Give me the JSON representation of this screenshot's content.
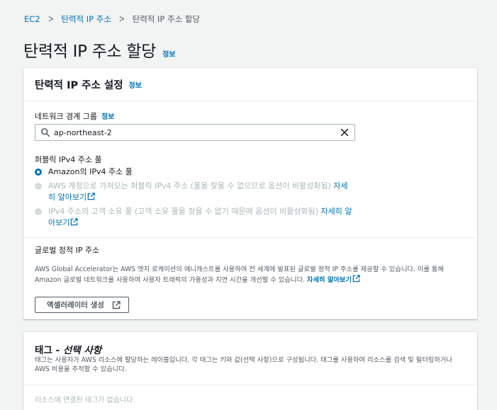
{
  "breadcrumb": {
    "items": [
      "EC2",
      "탄력적 IP 주소",
      "탄력적 IP 주소 할당"
    ]
  },
  "page": {
    "title": "탄력적 IP 주소 할당",
    "info": "정보"
  },
  "settings": {
    "title": "탄력적 IP 주소 설정",
    "info": "정보",
    "network_border_group": {
      "label": "네트워크 경계 그룹",
      "info": "정보",
      "value": "ap-northeast-2"
    },
    "pool": {
      "label": "퍼블릭 IPv4 주소 풀",
      "options": [
        {
          "text": "Amazon의 IPv4 주소 풀",
          "selected": true,
          "disabled": false,
          "link": ""
        },
        {
          "text": "AWS 계정으로 가져오는 퍼블릭 IPv4 주소 (풀을 찾을 수 없으므로 옵션이 비활성화됨)",
          "selected": false,
          "disabled": true,
          "link": "자세히 알아보기"
        },
        {
          "text": "IPv4 주소의 고객 소유 풀 (고객 소유 풀을 찾을 수 없기 때문에 옵션이 비활성화됨)",
          "selected": false,
          "disabled": true,
          "link": "자세히 알아보기"
        }
      ]
    },
    "global_ip": {
      "label": "글로벌 정적 IP 주소",
      "description": "AWS Global Accelerator는 AWS 엣지 로케이션의 애니캐스트를 사용하여 전 세계에 발표된 글로벌 정적 IP 주소를 제공할 수 있습니다. 이를 통해 Amazon 글로벌 네트워크를 사용하여 사용자 트래픽의 가용성과 지연 시간을 개선할 수 있습니다.",
      "learn_more": "자세히 알아보기",
      "button": "액셀러레이터 생성"
    }
  },
  "tags": {
    "title": "태그 - ",
    "title_em": "선택 사항",
    "description": "태그는 사용자가 AWS 리소스에 할당하는 레이블입니다. 각 태그는 키와 값(선택 사항)으로 구성됩니다. 태그를 사용하여 리소스를 검색 및 필터링하거나 AWS 비용을 추적할 수 있습니다.",
    "empty": "리소스에 연결된 태그가 없습니다."
  },
  "colors": {
    "link": "#0073bb",
    "background": "#f2f3f3",
    "disabled": "#aab7b8"
  }
}
